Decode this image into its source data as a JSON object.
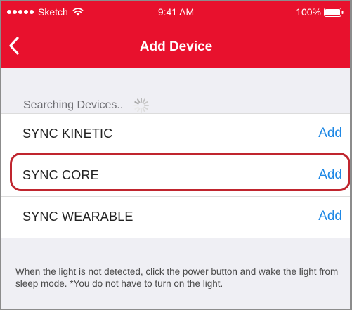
{
  "status_bar": {
    "carrier": "Sketch",
    "time": "9:41 AM",
    "battery": "100%"
  },
  "nav": {
    "title": "Add Device"
  },
  "search": {
    "label": "Searching Devices.."
  },
  "devices": [
    {
      "name": "SYNC KINETIC",
      "action": "Add"
    },
    {
      "name": "SYNC CORE",
      "action": "Add"
    },
    {
      "name": "SYNC WEARABLE",
      "action": "Add"
    }
  ],
  "footer": {
    "help_text": "When the light is not detected, click the power button and wake the light from sleep mode. *You do not have to turn on the light."
  },
  "colors": {
    "brand_red": "#e8112d",
    "link_blue": "#1e88e5",
    "highlight_border": "#c0252e",
    "background": "#efeff4"
  },
  "icons": [
    "signal-dots-icon",
    "wifi-icon",
    "battery-icon",
    "back-chevron-icon",
    "loading-spinner-icon"
  ]
}
